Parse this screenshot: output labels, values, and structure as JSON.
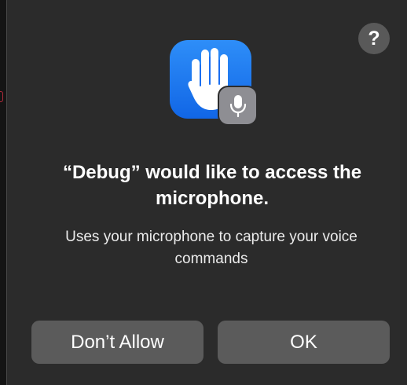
{
  "dialog": {
    "help_glyph": "?",
    "app_icon": "raised-hand-icon",
    "badge_icon": "microphone-icon",
    "title": "“Debug” would like to access the microphone.",
    "message": "Uses your microphone to capture your voice commands",
    "buttons": {
      "deny_label": "Don’t Allow",
      "ok_label": "OK"
    }
  },
  "colors": {
    "dialog_background": "#2b2b2b",
    "button_background": "#5b5b5b",
    "icon_blue": "#1a7af0",
    "badge_gray": "#8e8e93"
  }
}
